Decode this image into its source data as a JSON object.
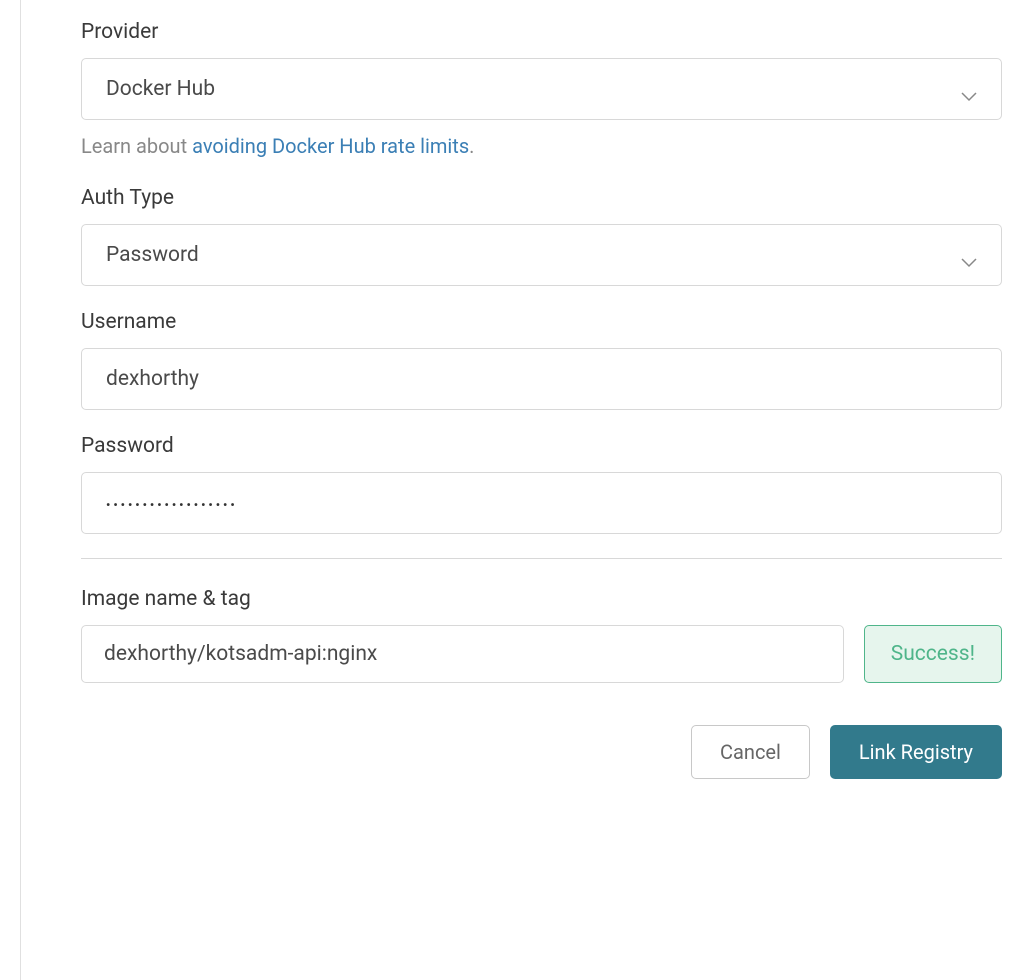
{
  "form": {
    "provider": {
      "label": "Provider",
      "value": "Docker Hub"
    },
    "helper": {
      "prefix": "Learn about ",
      "link_text": "avoiding Docker Hub rate limits",
      "suffix": "."
    },
    "auth_type": {
      "label": "Auth Type",
      "value": "Password"
    },
    "username": {
      "label": "Username",
      "value": "dexhorthy"
    },
    "password": {
      "label": "Password",
      "value": "••••••••••••••••••"
    },
    "image": {
      "label": "Image name & tag",
      "value": "dexhorthy/kotsadm-api:nginx"
    },
    "success_badge": "Success!",
    "buttons": {
      "cancel": "Cancel",
      "submit": "Link Registry"
    }
  }
}
